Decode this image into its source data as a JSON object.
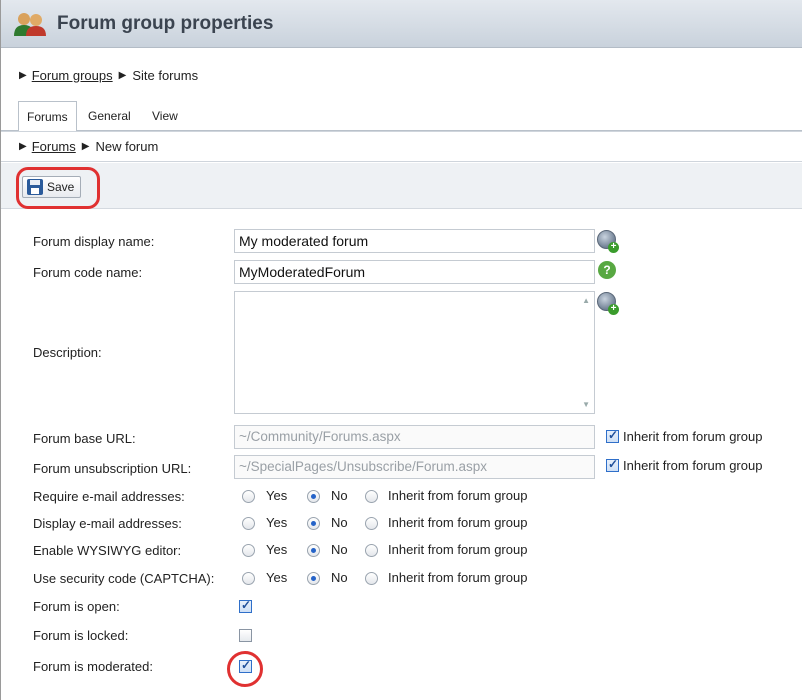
{
  "title_bar": {
    "title": "Forum group properties"
  },
  "breadcrumb_top": {
    "link": "Forum groups",
    "current": "Site forums"
  },
  "tabs": [
    {
      "label": "Forums",
      "active": true
    },
    {
      "label": "General",
      "active": false
    },
    {
      "label": "View",
      "active": false
    }
  ],
  "breadcrumb_sub": {
    "link": "Forums",
    "current": "New forum"
  },
  "toolbar": {
    "save_label": "Save"
  },
  "form": {
    "display_name": {
      "label": "Forum display name:",
      "value": "My moderated forum"
    },
    "code_name": {
      "label": "Forum code name:",
      "value": "MyModeratedForum"
    },
    "description": {
      "label": "Description:",
      "value": ""
    },
    "base_url": {
      "label": "Forum base URL:",
      "value": "~/Community/Forums.aspx",
      "inherit_label": "Inherit from forum group",
      "inherit_checked": true
    },
    "unsub_url": {
      "label": "Forum unsubscription URL:",
      "value": "~/SpecialPages/Unsubscribe/Forum.aspx",
      "inherit_label": "Inherit from forum group",
      "inherit_checked": true
    },
    "radio_labels": {
      "yes": "Yes",
      "no": "No",
      "inherit": "Inherit from forum group"
    },
    "require_email": {
      "label": "Require e-mail addresses:",
      "selected": "No"
    },
    "display_email": {
      "label": "Display e-mail addresses:",
      "selected": "No"
    },
    "wysiwyg": {
      "label": "Enable WYSIWYG editor:",
      "selected": "No"
    },
    "captcha": {
      "label": "Use security code (CAPTCHA):",
      "selected": "No"
    },
    "is_open": {
      "label": "Forum is open:",
      "checked": true
    },
    "is_locked": {
      "label": "Forum is locked:",
      "checked": false
    },
    "is_moderated": {
      "label": "Forum is moderated:",
      "checked": true
    }
  },
  "colors": {
    "highlight_ring": "#e03131",
    "accent": "#2563c8"
  }
}
